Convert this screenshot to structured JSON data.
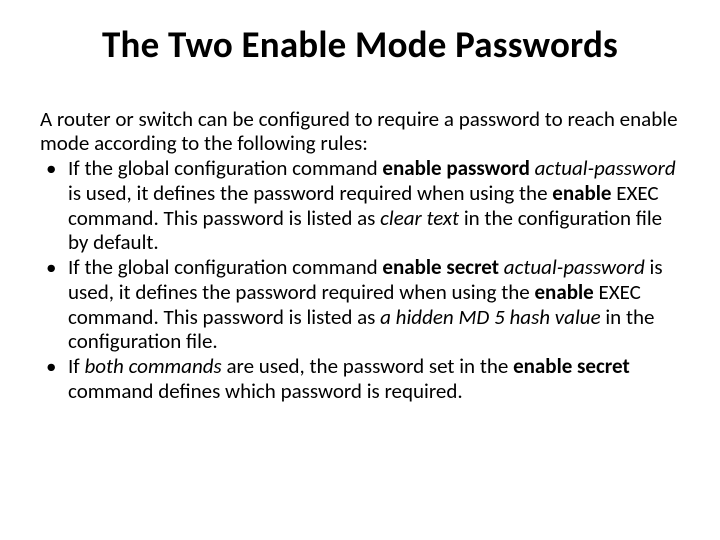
{
  "title": "The Two Enable Mode Passwords",
  "intro_a": "A router or switch can be configured to require a password to reach enable mode according to the following rules:",
  "bullet1": {
    "p1": "If the global configuration command ",
    "b1": "enable password ",
    "i1": "actual-password",
    "p2": " is used, it defines the password required when using the ",
    "b2": "enable",
    "p3": " EXEC command. This password is listed as ",
    "i2": "clear text",
    "p4": " in the configuration file by default."
  },
  "bullet2": {
    "p1": "If the global configuration command ",
    "b1": "enable secret ",
    "i1": "actual-password",
    "p2": " is used, it defines the password required when using the ",
    "b2": "enable",
    "p3": " EXEC command. This password is listed as ",
    "i2": "a hidden MD 5 hash value",
    "p4": " in the configuration file."
  },
  "bullet3": {
    "p1": "If ",
    "i1": "both commands",
    "p2": " are used, the password set in the ",
    "b1": "enable secret",
    "p3": " command defines which password is required."
  }
}
